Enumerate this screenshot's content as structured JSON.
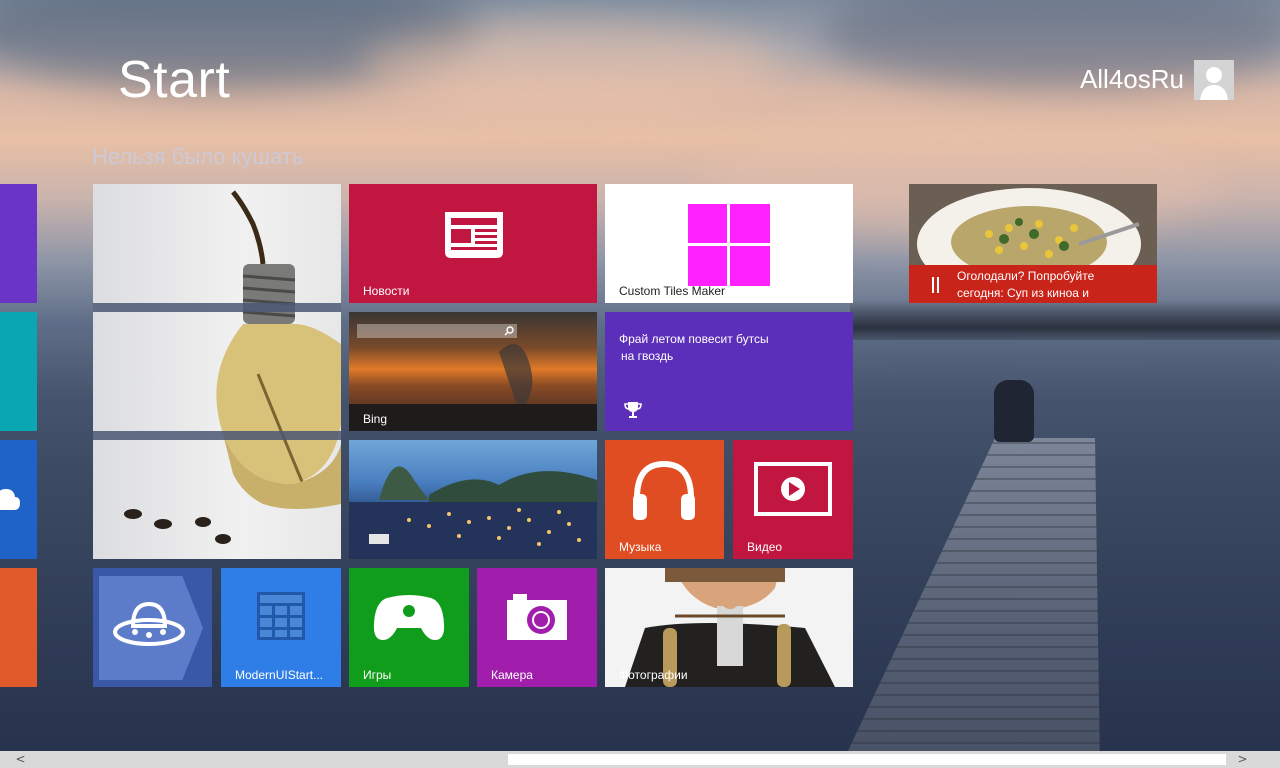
{
  "header": {
    "title": "Start",
    "user_name": "All4osRu"
  },
  "group": {
    "title": "Нельзя было кушать"
  },
  "tiles": {
    "news": {
      "label": "Новости",
      "color": "#c0163f"
    },
    "custom": {
      "label": "Custom Tiles Maker",
      "color": "#ffffff"
    },
    "food": {
      "line1": "Оголодали? Попробуйте",
      "line2": "сегодня: Суп из киноа и",
      "color": "#c9241a"
    },
    "bing": {
      "label": "Bing"
    },
    "tip": {
      "line1": "Фрай летом повесит бутсы",
      "line2": "на гвоздь",
      "color": "#5c2fba"
    },
    "music": {
      "label": "Музыка",
      "color": "#e04d22"
    },
    "video": {
      "label": "Видео",
      "color": "#c0163f"
    },
    "modernui": {
      "label": "ModernUIStart...",
      "color": "#2f7ee8"
    },
    "games": {
      "label": "Игры",
      "color": "#119d1c"
    },
    "camera": {
      "label": "Камера",
      "color": "#a11eac"
    },
    "photos": {
      "label": "Фотографии"
    }
  },
  "left_strip_colors": [
    "#6a35c6",
    "#0aa6b4",
    "#1f63c9",
    "#e05a2a"
  ],
  "icons": [
    "newspaper-icon",
    "windows-logo-icon",
    "fork-knife-icon",
    "search-icon",
    "trophy-icon",
    "headphones-icon",
    "play-icon",
    "ufo-icon",
    "table-icon",
    "gamepad-icon",
    "camera-icon",
    "cloud-icon",
    "user-icon"
  ],
  "scrollbar": {
    "left_arrow": "<",
    "right_arrow": ">"
  }
}
